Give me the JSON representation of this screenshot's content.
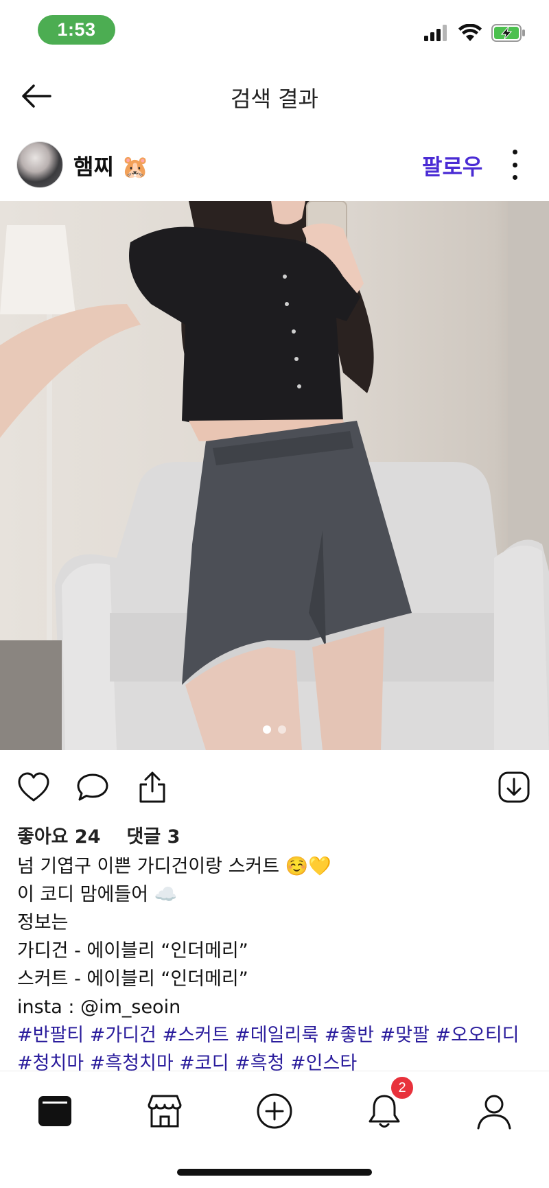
{
  "status_bar": {
    "time": "1:53",
    "icons": [
      "signal-icon",
      "wifi-icon",
      "battery-charging-icon"
    ],
    "time_pill_color": "#4cad52"
  },
  "nav": {
    "title": "검색 결과",
    "back_icon": "back-arrow-icon"
  },
  "post": {
    "username": "햄찌 🐹",
    "follow_label": "팔로우",
    "more_icon": "more-vertical-icon",
    "image_count": 2,
    "current_image": 1,
    "counts": {
      "likes_label": "좋아요 24",
      "comments_label": "댓글 3"
    },
    "caption_lines": [
      "넘 기엽구 이쁜 가디건이랑 스커트 ☺️💛",
      "이 코디 맘에들어 ☁️",
      "정보는",
      "가디건 - 에이블리 “인더메리”",
      "스커트 - 에이블리 “인더메리”",
      "insta : @im_seoin"
    ],
    "hashtags": "#반팔티 #가디건 #스커트 #데일리룩 #좋반 #맞팔 #오오티디 #청치마 #흑청치마 #코디 #흑청 #인스타",
    "accent_color": "#4a2bd4",
    "hashtag_color": "#2a1c9c"
  },
  "actions": [
    "heart-icon",
    "comment-icon",
    "share-icon",
    "download-icon"
  ],
  "tab_bar": {
    "items": [
      "feed-icon",
      "store-icon",
      "add-icon",
      "bell-icon",
      "profile-icon"
    ],
    "notification_badge": "2",
    "badge_color": "#e8323c"
  }
}
